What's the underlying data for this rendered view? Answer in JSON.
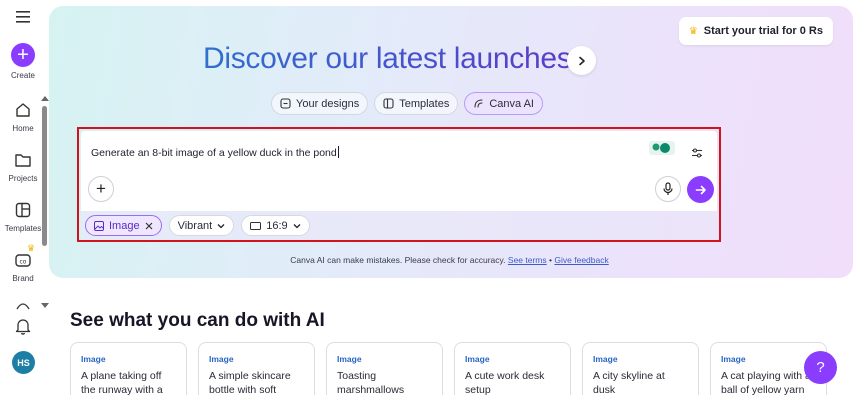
{
  "sidebar": {
    "create_label": "Create",
    "items": [
      {
        "label": "Home",
        "icon": "home-icon"
      },
      {
        "label": "Projects",
        "icon": "folder-icon"
      },
      {
        "label": "Templates",
        "icon": "templates-icon"
      },
      {
        "label": "Brand",
        "icon": "brand-icon"
      }
    ],
    "avatar_initials": "HS"
  },
  "hero": {
    "trial_label": "Start your trial for 0 Rs",
    "headline": "Discover our latest launches",
    "tabs": [
      {
        "label": "Your designs",
        "icon": "designs-icon"
      },
      {
        "label": "Templates",
        "icon": "templates-icon"
      },
      {
        "label": "Canva AI",
        "icon": "canva-ai-icon"
      }
    ]
  },
  "prompt": {
    "text": "Generate an 8-bit image of a yellow duck in the pond",
    "options": {
      "image_label": "Image",
      "style_label": "Vibrant",
      "ratio_label": "16:9"
    }
  },
  "disclaimer": {
    "text": "Canva AI can make mistakes. Please check for accuracy.",
    "terms_link": "See terms",
    "separator": "•",
    "feedback_link": "Give feedback"
  },
  "section": {
    "title": "See what you can do with AI",
    "cards": [
      {
        "tag": "Image",
        "text": "A plane taking off the runway with a"
      },
      {
        "tag": "Image",
        "text": "A simple skincare bottle with soft"
      },
      {
        "tag": "Image",
        "text": "Toasting marshmallows"
      },
      {
        "tag": "Image",
        "text": "A cute work desk setup"
      },
      {
        "tag": "Image",
        "text": "A city skyline at dusk"
      },
      {
        "tag": "Image",
        "text": "A cat playing with a ball of yellow yarn"
      }
    ]
  },
  "help_label": "?",
  "colors": {
    "accent": "#8b3dff",
    "highlight_border": "#d0141d",
    "link": "#3b5cc9"
  }
}
